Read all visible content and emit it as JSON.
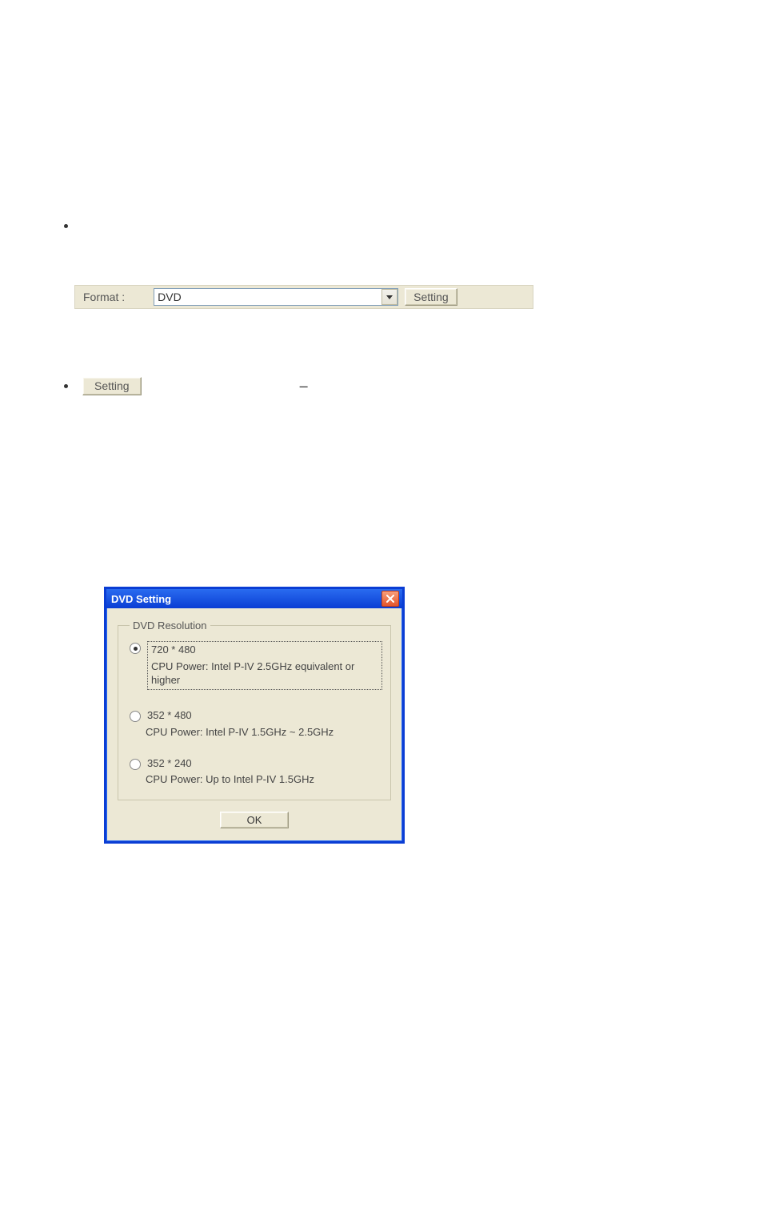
{
  "row1": {
    "format_label": "Format :",
    "format_value": "DVD",
    "setting_button": "Setting"
  },
  "row2": {
    "setting_button": "Setting",
    "dash": "–"
  },
  "dialog": {
    "title": "DVD Setting",
    "group_legend": "DVD Resolution",
    "options": [
      {
        "label": "720 * 480",
        "desc": "CPU Power: Intel P-IV 2.5GHz equivalent or higher",
        "checked": true
      },
      {
        "label": "352 * 480",
        "desc": "CPU Power: Intel P-IV 1.5GHz ~ 2.5GHz",
        "checked": false
      },
      {
        "label": "352 * 240",
        "desc": "CPU Power: Up to Intel P-IV 1.5GHz",
        "checked": false
      }
    ],
    "ok_button": "OK"
  }
}
